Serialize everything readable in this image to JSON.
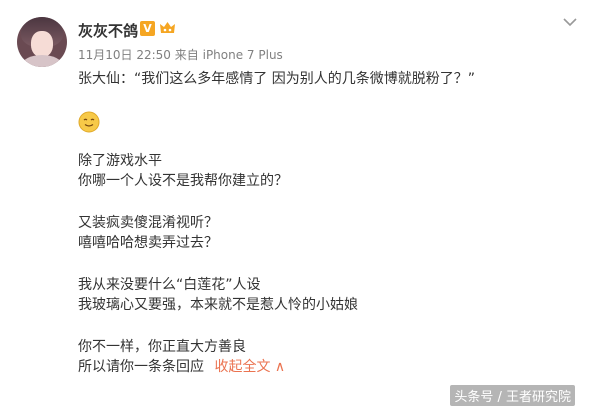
{
  "post": {
    "author": "灰灰不鸽",
    "verified_badge": "V",
    "member_icon": "crown-icon",
    "time": "11月10日 22:50",
    "source_prefix": "来自",
    "source": "iPhone 7 Plus",
    "lines": {
      "quote": "张大仙：“我们这么多年感情了 因为别人的几条微博就脱粉了？”",
      "p1": "除了游戏水平",
      "p2": "你哪一个人设不是我帮你建立的？",
      "p3": "又装疯卖傻混淆视听？",
      "p4": "嘻嘻哈哈想卖弄过去？",
      "p5": "我从来没要什么“白莲花”人设",
      "p6": "我玻璃心又要强，本来就不是惹人怜的小姑娘",
      "p7": "你不一样，你正直大方善良",
      "p8": "所以请你一条条回应"
    },
    "collapse_label": "收起全文",
    "collapse_arrow": "∧"
  },
  "watermark": "头条号 / 王者研究院",
  "colors": {
    "badge_orange": "#f5a623",
    "link_orange": "#eb7350",
    "meta_gray": "#808080",
    "text": "#333333"
  }
}
